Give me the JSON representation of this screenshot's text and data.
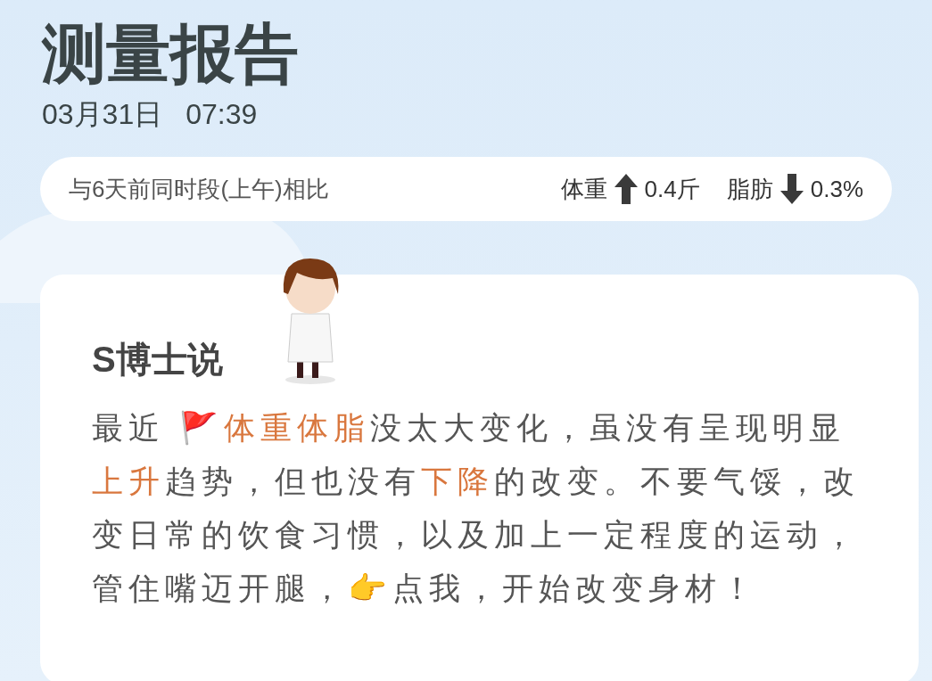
{
  "header": {
    "title": "测量报告",
    "date": "03月31日",
    "time": "07:39"
  },
  "comparison": {
    "label": "与6天前同时段(上午)相比",
    "items": [
      {
        "name": "体重",
        "kind": "increase",
        "value": "0.4斤"
      },
      {
        "name": "脂肪",
        "kind": "decrease",
        "value": "0.3%"
      }
    ]
  },
  "advice": {
    "title": "S博士说",
    "segments": [
      {
        "text": "最近  ",
        "highlight": false
      },
      {
        "text": "🚩"
      },
      {
        "text": "体重体脂",
        "highlight": true
      },
      {
        "text": "没太大变化，虽没有呈现明显",
        "highlight": false
      },
      {
        "text": "上升",
        "highlight": true
      },
      {
        "text": "趋势，但也没有",
        "highlight": false
      },
      {
        "text": "下降",
        "highlight": true
      },
      {
        "text": "的改变。不要气馁，改变日常的饮食习惯，以及加上一定程度的运动，管住嘴迈开腿，",
        "highlight": false
      },
      {
        "text": "👉"
      },
      {
        "text": "点我，开始改变身材！",
        "highlight": false
      }
    ]
  }
}
